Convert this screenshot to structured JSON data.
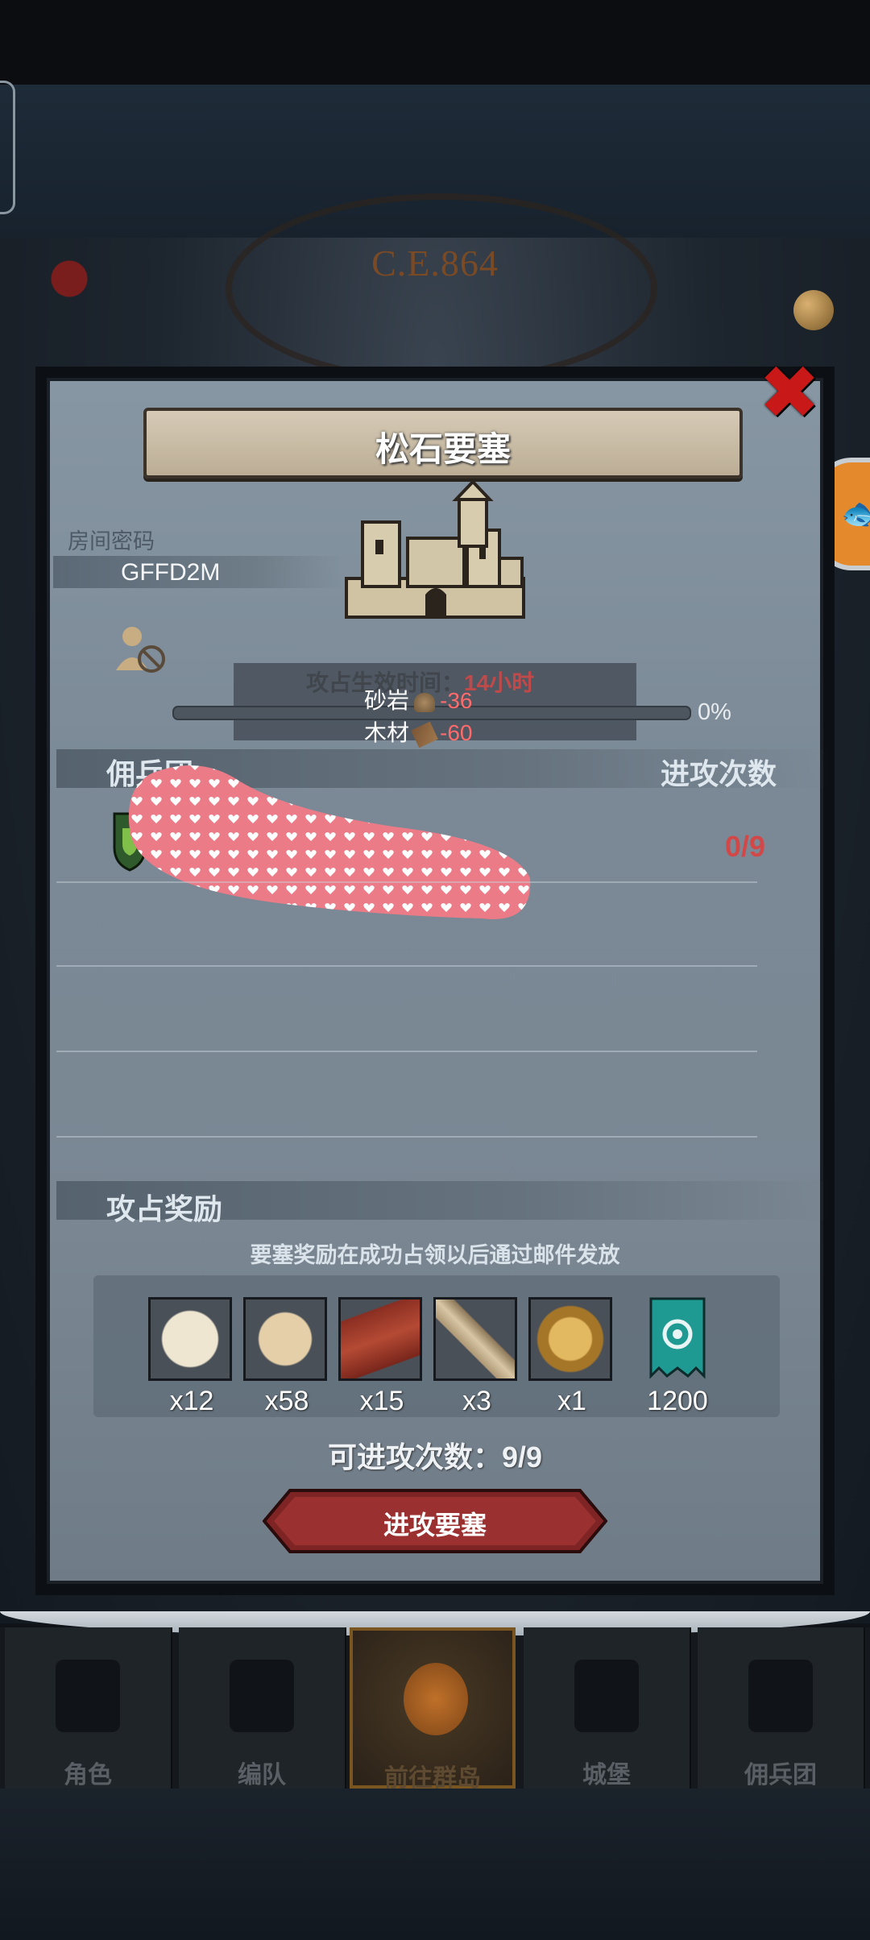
{
  "header": {
    "year": "C.E.864"
  },
  "dialog": {
    "title": "松石要塞",
    "room_label": "房间密码",
    "room_code": "GFFD2M",
    "capture_time_prefix": "攻占生效时间：",
    "capture_time_value": "14小时",
    "progress_percent": "0%",
    "resources": [
      {
        "name": "砂岩",
        "icon": "sandstone-icon",
        "value": "-36"
      },
      {
        "name": "木材",
        "icon": "wood-icon",
        "value": "-60"
      }
    ],
    "mercenary_heading": "佣兵团",
    "attack_count_heading": "进攻次数",
    "attack_count_value": "0/9",
    "rewards_heading": "攻占奖励",
    "rewards_note": "要塞奖励在成功占领以后通过邮件发放",
    "rewards": [
      {
        "icon": "fur-icon",
        "qty": "x12"
      },
      {
        "icon": "hide-icon",
        "qty": "x58"
      },
      {
        "icon": "wood-planks-icon",
        "qty": "x15"
      },
      {
        "icon": "horn-icon",
        "qty": "x3"
      },
      {
        "icon": "helmet-medal-icon",
        "qty": "x1"
      },
      {
        "icon": "banner-icon",
        "qty": "1200"
      }
    ],
    "attack_times_text": "可进攻次数：9/9",
    "attack_button": "进攻要塞"
  },
  "nav": [
    {
      "label": "角色",
      "icon": "character-icon",
      "active": false
    },
    {
      "label": "编队",
      "icon": "formation-icon",
      "active": false
    },
    {
      "label": "前往群岛",
      "icon": "islands-icon",
      "active": true
    },
    {
      "label": "城堡",
      "icon": "castle-icon",
      "active": false
    },
    {
      "label": "佣兵团",
      "icon": "mercenary-icon",
      "active": false
    }
  ],
  "colors": {
    "danger": "#d24848",
    "panel": "#7b8996",
    "button": "#8a2a2a"
  }
}
